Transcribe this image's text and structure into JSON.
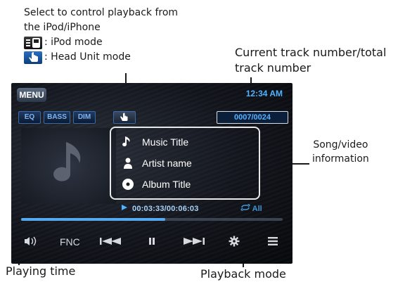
{
  "annotations": {
    "select_line1": "Select to control playback from",
    "select_line2": "the iPod/iPhone",
    "ipod_mode": ": iPod mode",
    "head_unit_mode": ": Head Unit mode",
    "track_line1": "Current track number/total",
    "track_line2": "track number",
    "song_line1": "Song/video",
    "song_line2": "information",
    "playing_time": "Playing time",
    "playback_mode": "Playback mode"
  },
  "screen": {
    "menu_label": "MENU",
    "clock": "12:34 AM",
    "top_buttons": {
      "eq": "EQ",
      "bass": "BASS",
      "dim": "DIM"
    },
    "track_number": "0007/0024",
    "song": {
      "title": "Music Title",
      "artist": "Artist name",
      "album": "Album Title"
    },
    "time": "00:03:33/00:06:03",
    "repeat_label": "All",
    "progress_fraction": 0.55,
    "controls": {
      "fnc": "FNC"
    }
  },
  "icons": [
    "music-note-icon",
    "person-icon",
    "disc-icon",
    "hand-pointer-icon",
    "ipod-mode-icon",
    "volume-icon",
    "previous-track-icon",
    "pause-icon",
    "next-track-icon",
    "settings-icon",
    "menu-list-icon",
    "play-arrow-icon",
    "repeat-icon",
    "speaker-icon"
  ],
  "colors": {
    "accent": "#4fb3ff",
    "progress": "#56a8ef",
    "screen_bg": "#12151c"
  }
}
